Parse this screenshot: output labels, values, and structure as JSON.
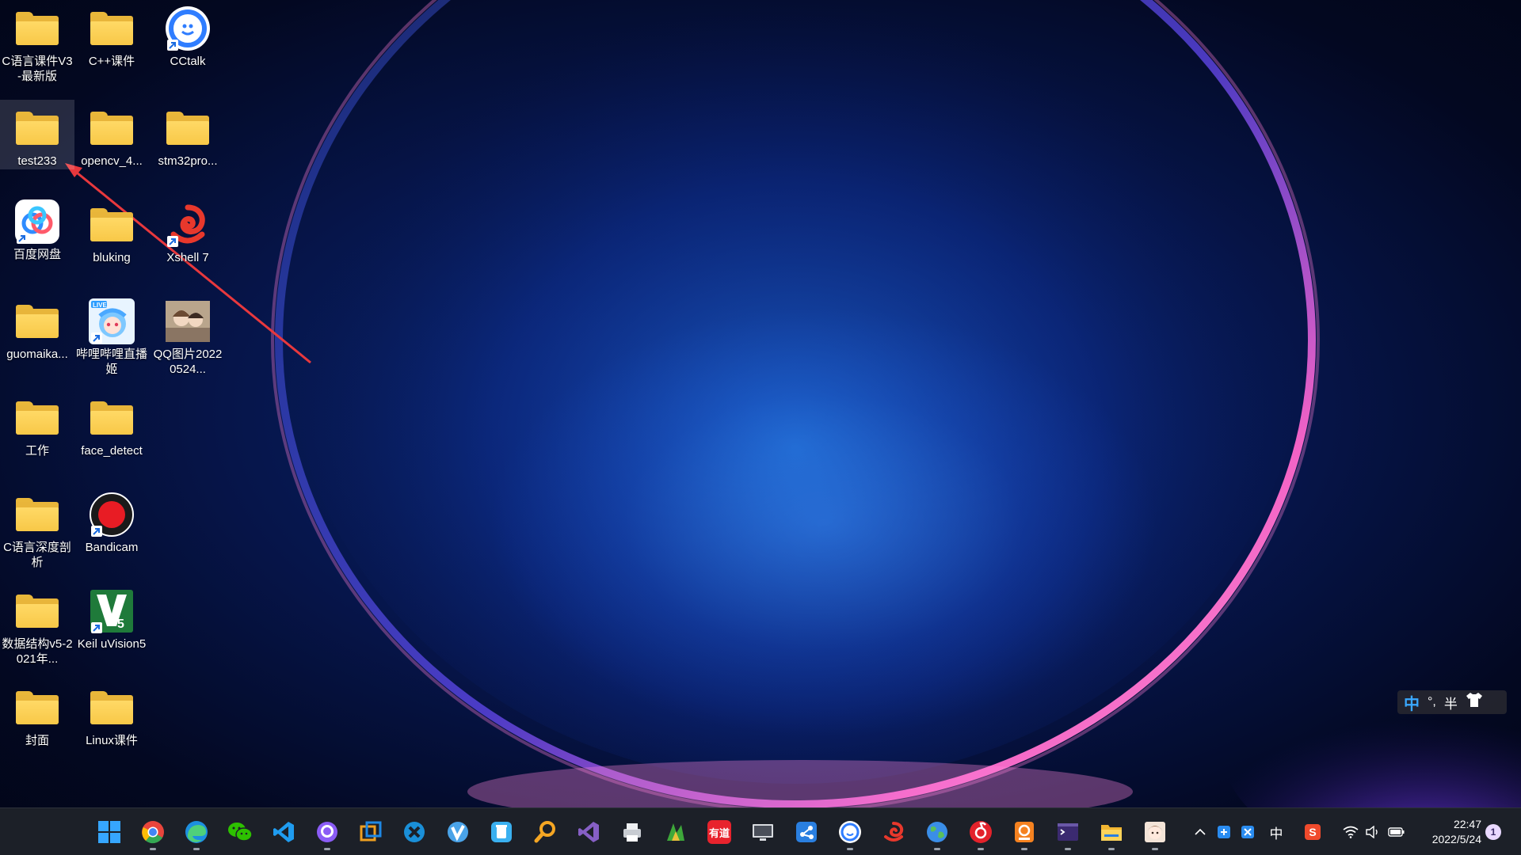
{
  "desktop": {
    "icons": [
      {
        "label": "C语言课件V3-最新版",
        "icon": "folder-icon"
      },
      {
        "label": "C++课件",
        "icon": "folder-icon"
      },
      {
        "label": "CCtalk",
        "icon": "cctalk-icon"
      },
      {
        "label": "test233",
        "icon": "folder-icon"
      },
      {
        "label": "opencv_4...",
        "icon": "folder-icon"
      },
      {
        "label": "stm32pro...",
        "icon": "folder-icon"
      },
      {
        "label": "百度网盘",
        "icon": "baidu-netdisk-icon"
      },
      {
        "label": "bluking",
        "icon": "folder-icon"
      },
      {
        "label": "Xshell 7",
        "icon": "xshell-icon"
      },
      {
        "label": "guomaika...",
        "icon": "folder-icon"
      },
      {
        "label": "哔哩哔哩直播姬",
        "icon": "bilibili-live-icon"
      },
      {
        "label": "QQ图片20220524...",
        "icon": "image-thumbnail-icon"
      },
      {
        "label": "工作",
        "icon": "folder-icon"
      },
      {
        "label": "face_detect",
        "icon": "folder-icon"
      },
      {
        "label": "C语言深度剖析",
        "icon": "folder-icon"
      },
      {
        "label": "Bandicam",
        "icon": "bandicam-icon"
      },
      {
        "label": "数据结构v5-2021年...",
        "icon": "folder-icon"
      },
      {
        "label": "Keil uVision5",
        "icon": "keil-icon"
      },
      {
        "label": "封面",
        "icon": "folder-icon"
      },
      {
        "label": "Linux课件",
        "icon": "folder-icon"
      }
    ],
    "selected": "test233",
    "annotation": "red-arrow-pointing-to-test233"
  },
  "ime_bar": {
    "mode": "中",
    "punct": "°,",
    "width": "半",
    "skin_icon": "shirt-icon"
  },
  "taskbar": {
    "apps": [
      {
        "name": "start-menu-icon"
      },
      {
        "name": "chrome-icon"
      },
      {
        "name": "edge-icon"
      },
      {
        "name": "wechat-icon"
      },
      {
        "name": "vscode-icon"
      },
      {
        "name": "github-desktop-icon"
      },
      {
        "name": "vmware-icon"
      },
      {
        "name": "xmind-icon"
      },
      {
        "name": "v-app-icon"
      },
      {
        "name": "recycle-bin-icon"
      },
      {
        "name": "search-tool-icon"
      },
      {
        "name": "visual-studio-icon"
      },
      {
        "name": "printer-icon"
      },
      {
        "name": "game-icon"
      },
      {
        "name": "youdao-icon",
        "text": "有道"
      },
      {
        "name": "monitor-icon"
      },
      {
        "name": "network-tool-icon"
      },
      {
        "name": "cctalk-icon"
      },
      {
        "name": "xshell-icon"
      },
      {
        "name": "globe-icon"
      },
      {
        "name": "netease-music-icon"
      },
      {
        "name": "pdf-icon"
      },
      {
        "name": "terminal-icon"
      },
      {
        "name": "file-explorer-icon"
      },
      {
        "name": "anime-avatar-icon"
      }
    ],
    "tray": {
      "show_hidden": "^",
      "ime": "中",
      "sogou": "S"
    },
    "clock": {
      "time": "22:47",
      "date": "2022/5/24"
    },
    "notification_count": "1"
  },
  "colors": {
    "folder": "#f8c847",
    "annotation_arrow": "#e8383d",
    "taskbar_bg": "#1c2028"
  }
}
